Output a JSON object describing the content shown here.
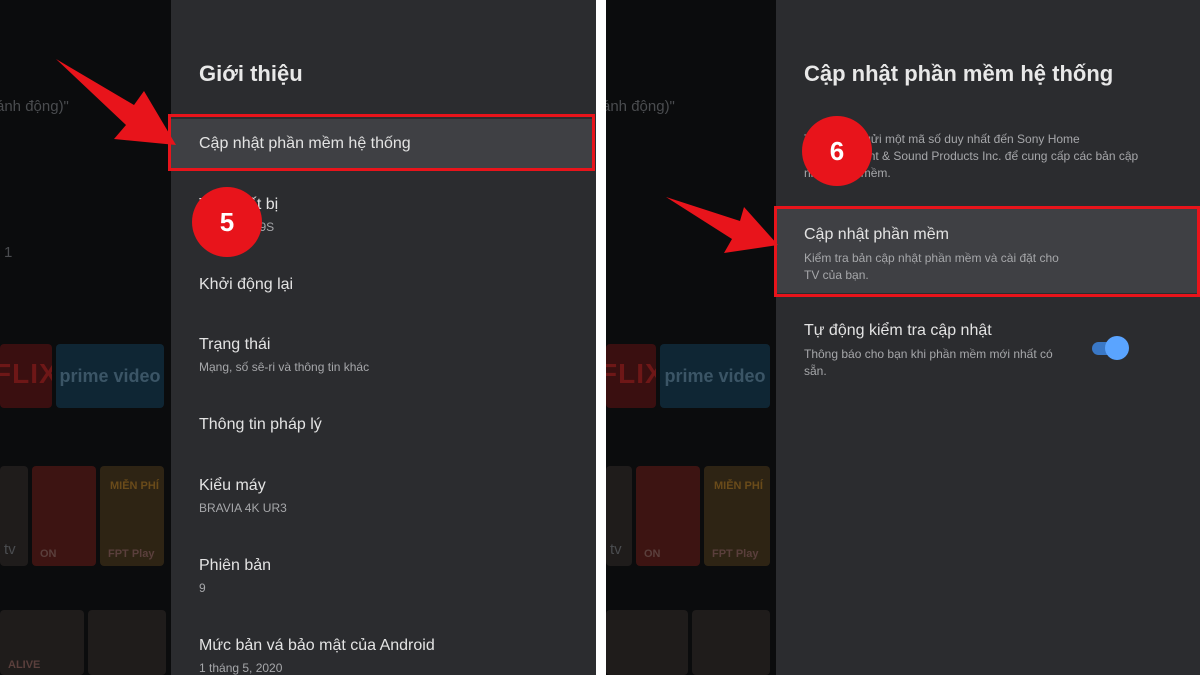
{
  "left_panel": {
    "background": {
      "text_top": "ánh động)\"",
      "text_num": "1",
      "netflix_label": "FLIX",
      "prime_label": "prime video",
      "thumb_label_top": "MIỄN PHÍ",
      "thumb_label_on": "ON",
      "thumb_label_fpt": "FPT Play",
      "text_tv": "tv",
      "thumb_label_alive": "ALIVE"
    },
    "settings": {
      "title": "Giới thiệu",
      "items": [
        {
          "label": "Cập nhật phần mềm hệ thống"
        },
        {
          "label": "Tên thiết bị",
          "sub": "BRAVIA 8A9S"
        },
        {
          "label": "Khởi động lại"
        },
        {
          "label": "Trạng thái",
          "sub": "Mạng, số sê-ri và thông tin khác"
        },
        {
          "label": "Thông tin pháp lý"
        },
        {
          "label": "Kiểu máy",
          "sub": "BRAVIA 4K UR3"
        },
        {
          "label": "Phiên bản",
          "sub": "9"
        },
        {
          "label": "Mức bản vá bảo mật của Android",
          "sub": "1 tháng 5, 2020"
        }
      ]
    },
    "step_badge": "5"
  },
  "right_panel": {
    "background": {
      "text_top": "ánh động)\"",
      "netflix_label": "FLIX",
      "prime_label": "prime video",
      "thumb_label_top": "MIỄN PHÍ",
      "thumb_label_on": "ON",
      "thumb_label_fpt": "FPT Play",
      "text_tv": "tv"
    },
    "settings": {
      "title": "Cập nhật phần mềm hệ thống",
      "description": "Tivi này sẽ gửi một mã số duy nhất đến Sony Home Entertainment & Sound Products Inc. để cung cấp các bản cập nhật phần mềm.",
      "options": [
        {
          "label": "Cập nhật phần mềm",
          "sub": "Kiểm tra bản cập nhật phần mềm và cài đặt cho TV của bạn."
        },
        {
          "label": "Tự động kiểm tra cập nhật",
          "sub": "Thông báo cho bạn khi phần mềm mới nhất có sẵn.",
          "toggle": "on"
        }
      ]
    },
    "step_badge": "6"
  },
  "colors": {
    "highlight": "#e8141b",
    "panel": "#2b2c2f",
    "toggle_on": "#5aa4ff"
  }
}
